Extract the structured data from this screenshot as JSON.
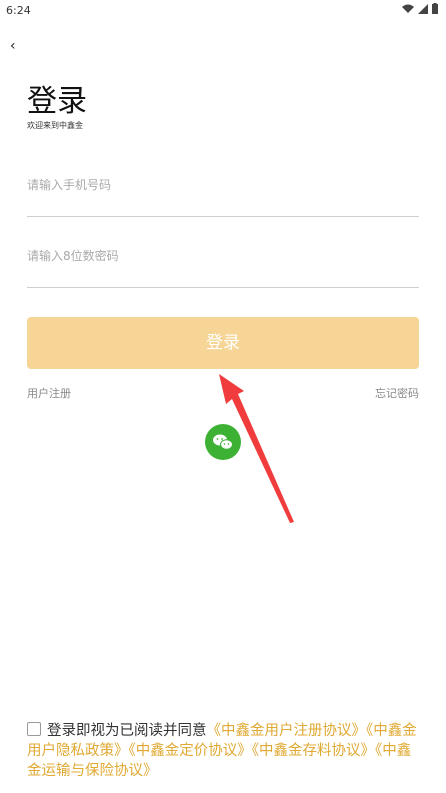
{
  "status_bar": {
    "time": "6:24"
  },
  "header": {
    "back_label": "‹"
  },
  "page": {
    "title": "登录",
    "subtitle": "欢迎来到中鑫金"
  },
  "form": {
    "phone_placeholder": "请输入手机号码",
    "password_placeholder": "请输入8位数密码",
    "login_button": "登录",
    "register_link": "用户注册",
    "forgot_link": "忘记密码"
  },
  "social": {
    "icon": "wechat-icon"
  },
  "agreement": {
    "prefix": "登录即视为已阅读并同意",
    "doc1": "《中鑫金用户注册协议》",
    "doc2": "《中鑫金用户隐私政策》",
    "doc3": "《中鑫金定价协议》",
    "doc4": "《中鑫金存料协议》",
    "doc5": "《中鑫金运输与保险协议》"
  },
  "colors": {
    "accent": "#f6d596",
    "link": "#e0a933",
    "wechat": "#3db134",
    "annotation_arrow": "#f03c3c"
  }
}
